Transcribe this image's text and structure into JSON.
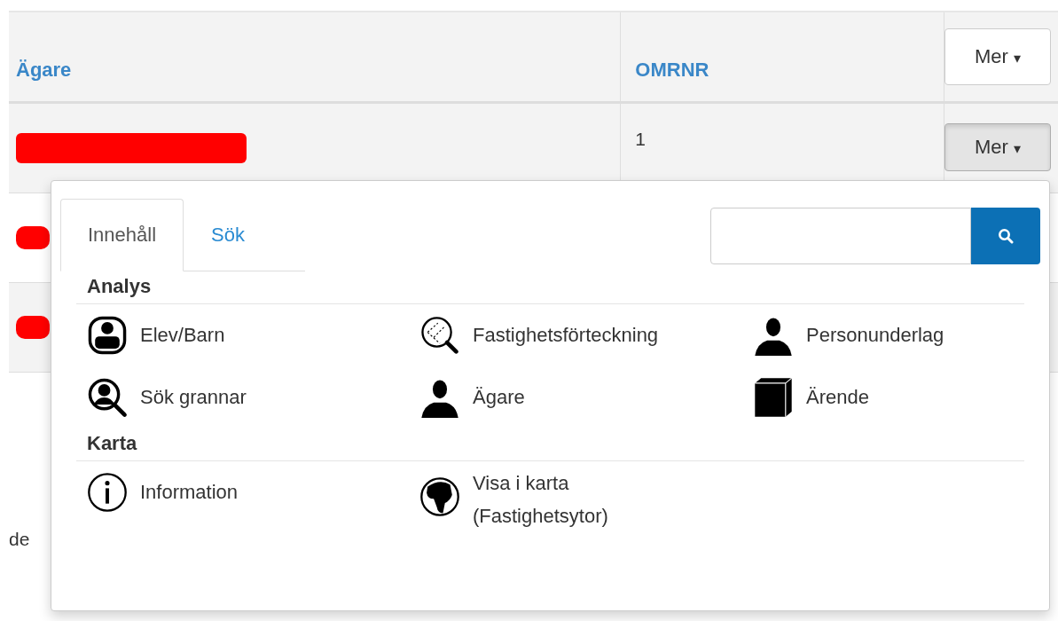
{
  "table": {
    "columns": [
      {
        "label": "Ägare"
      },
      {
        "label": "OMRNR"
      }
    ],
    "header_button": {
      "label": "Mer",
      "caret": "▾"
    },
    "rows": [
      {
        "owner_redacted": true,
        "omrnr": "1",
        "button": {
          "label": "Mer",
          "caret": "▾",
          "active": true
        },
        "shaded": true
      },
      {
        "owner_redacted": true,
        "shaded": false
      },
      {
        "owner_redacted": true,
        "shaded": true
      }
    ],
    "below_text": "de"
  },
  "dropdown": {
    "tabs": [
      {
        "label": "Innehåll",
        "selected": true
      },
      {
        "label": "Sök",
        "selected": false
      }
    ],
    "sections": [
      {
        "title": "Analys",
        "items": [
          {
            "label": "Elev/Barn",
            "kind": "student"
          },
          {
            "label": "Fastighetsförteckning",
            "kind": "parcel"
          },
          {
            "label": "Personunderlag",
            "kind": "person"
          },
          {
            "label": "Sök grannar",
            "kind": "neighbours"
          },
          {
            "label": "Ägare",
            "kind": "person"
          },
          {
            "label": "Ärende",
            "kind": "case"
          }
        ]
      },
      {
        "title": "Karta",
        "items": [
          {
            "label": "Information",
            "kind": "info"
          },
          {
            "label": "Visa i karta (Fastighetsytor)",
            "kind": "map"
          }
        ]
      }
    ]
  }
}
